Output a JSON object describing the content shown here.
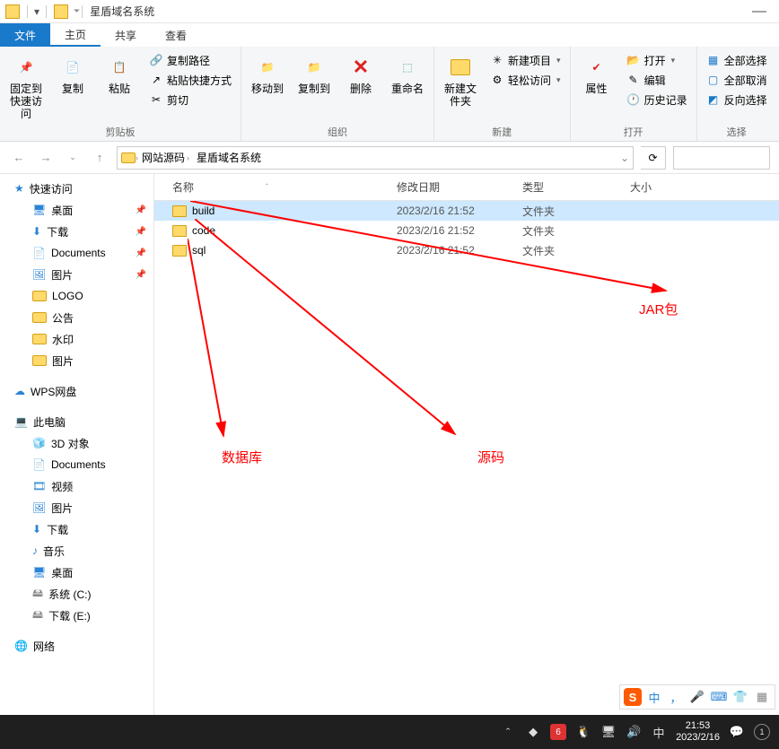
{
  "titlebar": {
    "title": "星盾域名系统"
  },
  "tabs": {
    "file": "文件",
    "home": "主页",
    "share": "共享",
    "view": "查看"
  },
  "ribbon": {
    "clipboard": {
      "label": "剪贴板",
      "pin": "固定到快速访问",
      "copy": "复制",
      "paste": "粘贴",
      "copy_path": "复制路径",
      "paste_shortcut": "粘贴快捷方式",
      "cut": "剪切"
    },
    "organize": {
      "label": "组织",
      "move": "移动到",
      "copy_to": "复制到",
      "delete": "删除",
      "rename": "重命名"
    },
    "new": {
      "label": "新建",
      "new_folder": "新建文件夹",
      "new_item": "新建项目",
      "easy_access": "轻松访问"
    },
    "open": {
      "label": "打开",
      "properties": "属性",
      "open": "打开",
      "edit": "编辑",
      "history": "历史记录"
    },
    "select": {
      "label": "选择",
      "select_all": "全部选择",
      "select_none": "全部取消",
      "invert": "反向选择"
    }
  },
  "breadcrumb": {
    "items": [
      "网站源码",
      "星盾域名系统"
    ]
  },
  "sidebar": {
    "quick_access": "快速访问",
    "desktop": "桌面",
    "downloads": "下载",
    "documents": "Documents",
    "pictures": "图片",
    "logo": "LOGO",
    "notice": "公告",
    "watermark": "水印",
    "pictures2": "图片",
    "wps": "WPS网盘",
    "this_pc": "此电脑",
    "pc_items": [
      "3D 对象",
      "Documents",
      "视频",
      "图片",
      "下载",
      "音乐",
      "桌面",
      "系统 (C:)",
      "下载 (E:)"
    ],
    "network": "网络"
  },
  "columns": {
    "name": "名称",
    "date": "修改日期",
    "type": "类型",
    "size": "大小"
  },
  "files": [
    {
      "name": "build",
      "date": "2023/2/16 21:52",
      "type": "文件夹",
      "selected": true
    },
    {
      "name": "code",
      "date": "2023/2/16 21:52",
      "type": "文件夹",
      "selected": false
    },
    {
      "name": "sql",
      "date": "2023/2/16 21:52",
      "type": "文件夹",
      "selected": false
    }
  ],
  "annotations": {
    "jar": "JAR包",
    "source": "源码",
    "db": "数据库"
  },
  "ime": {
    "zh": "中",
    "dot": "，",
    "zh2": "中"
  },
  "clock": {
    "time": "21:53",
    "date": "2023/2/16"
  }
}
